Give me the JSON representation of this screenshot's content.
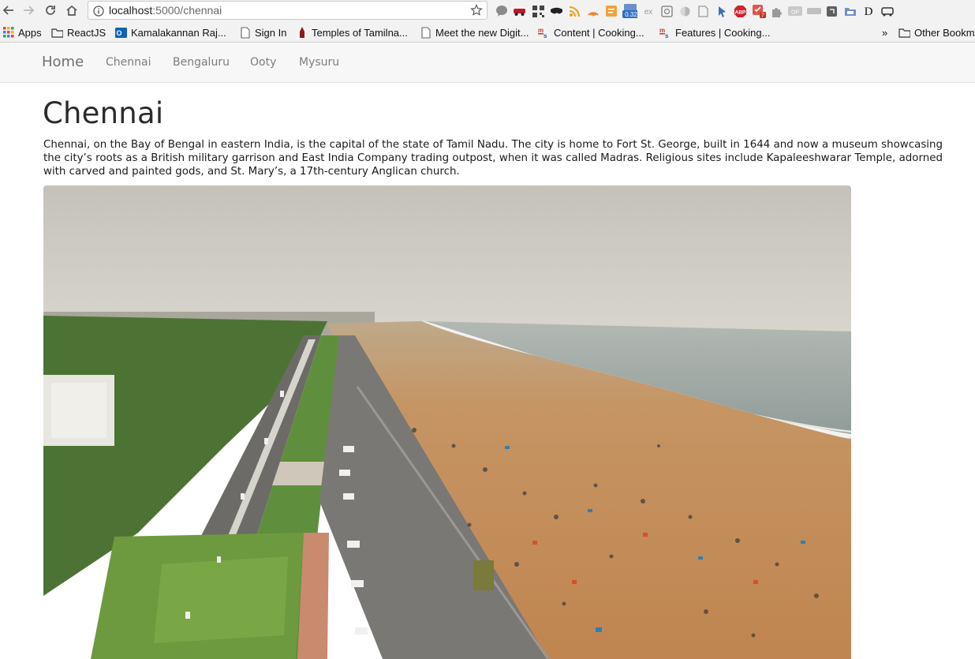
{
  "browser": {
    "url_host": "localhost",
    "url_path": ":5000/chennai",
    "ext_badge": "0.32",
    "ext_abp": "ABP",
    "ext_count": "7",
    "ext_ex": "ex",
    "ext_d": "D"
  },
  "bookmarks": [
    {
      "label": "Apps",
      "icon": "apps-grid-icon"
    },
    {
      "label": "ReactJS",
      "icon": "folder-icon"
    },
    {
      "label": "Kamalakannan Raj...",
      "icon": "outlook-icon"
    },
    {
      "label": "Sign In",
      "icon": "page-icon"
    },
    {
      "label": "Temples of Tamilna...",
      "icon": "temple-icon"
    },
    {
      "label": "Meet the new Digit...",
      "icon": "page-icon"
    },
    {
      "label": "Content | Cooking...",
      "icon": "ms-icon"
    },
    {
      "label": "Features | Cooking...",
      "icon": "ms-icon"
    }
  ],
  "bookmarks_overflow": "»",
  "other_bookmarks": "Other Bookm",
  "navbar": {
    "brand": "Home",
    "links": [
      "Chennai",
      "Bengaluru",
      "Ooty",
      "Mysuru"
    ]
  },
  "page": {
    "title": "Chennai",
    "description": "Chennai, on the Bay of Bengal in eastern India, is the capital of the state of Tamil Nadu. The city is home to Fort St. George, built in 1644 and now a museum showcasing the city’s roots as a British military garrison and East India Company trading outpost, when it was called Madras. Religious sites include Kapaleeshwarar Temple, adorned with carved and painted gods, and St. Mary’s, a 17th-century Anglican church."
  },
  "colors": {
    "sky": "#c9c6bd",
    "sea": "#9fa9a6",
    "sand": "#c7925a",
    "greenery": "#4f7a35",
    "road": "#6e6c68"
  }
}
